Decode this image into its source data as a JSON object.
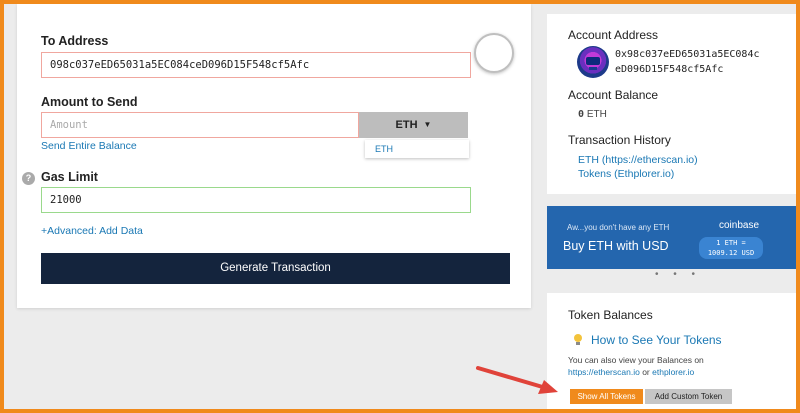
{
  "send_form": {
    "to_address_label": "To Address",
    "to_address_value": "098c037eED65031a5EC084ceD096D15F548cf5Afc",
    "amount_label": "Amount to Send",
    "amount_placeholder": "Amount",
    "currency_selected": "ETH",
    "currency_options": [
      "ETH"
    ],
    "send_entire_balance": "Send Entire Balance",
    "gas_limit_label": "Gas Limit",
    "gas_limit_value": "21000",
    "advanced_link": "+Advanced: Add Data",
    "generate_button": "Generate Transaction",
    "help_glyph": "?"
  },
  "account": {
    "address_title": "Account Address",
    "address_line1": "0x98c037eED65031a5EC084c",
    "address_line2": "eD096D15F548cf5Afc",
    "balance_title": "Account Balance",
    "balance_amount": "0",
    "balance_unit": "ETH",
    "history_title": "Transaction History",
    "history_links": [
      "ETH (https://etherscan.io)",
      "Tokens (Ethplorer.io)"
    ]
  },
  "coinbase_banner": {
    "small_text": "Aw...you don't have any ETH",
    "headline": "Buy ETH with USD",
    "brand": "coinbase",
    "price_line1": "1 ETH =",
    "price_line2": "1009.12 USD",
    "dots": "• • •"
  },
  "tokens": {
    "title": "Token Balances",
    "how_to_link": "How to See Your Tokens",
    "desc_text": "You can also view your Balances on",
    "link_etherscan": "https://etherscan.io",
    "or_text": "or",
    "link_ethplorer": "ethplorer.io",
    "show_all_button": "Show All Tokens",
    "add_custom_button": "Add Custom Token"
  },
  "colors": {
    "accent_orange": "#f08a1c",
    "dark_navy": "#14243d",
    "link_blue": "#1a78b4",
    "coinbase_blue": "#2466ae"
  }
}
